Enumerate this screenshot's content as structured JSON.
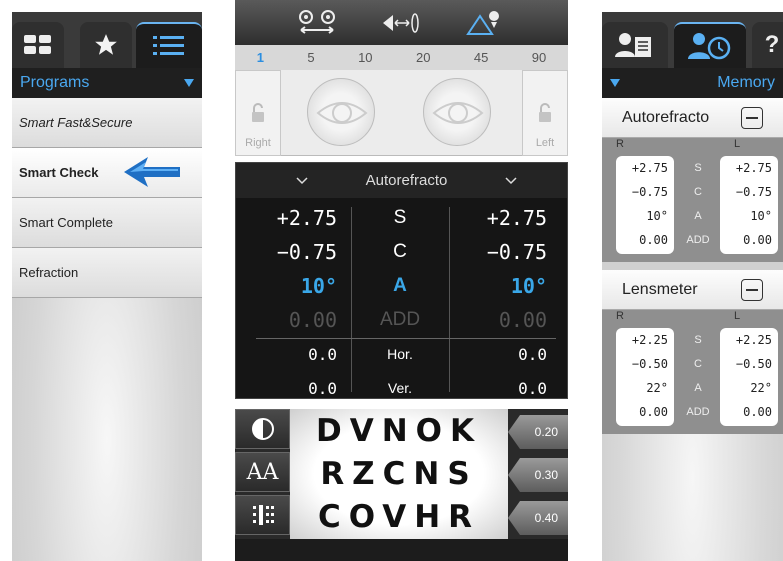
{
  "left_panel": {
    "header_title": "Programs",
    "items": [
      {
        "label": "Smart Fast&Secure",
        "italic": true
      },
      {
        "label": "Smart Check",
        "active": true
      },
      {
        "label": "Smart Complete"
      },
      {
        "label": "Refraction"
      }
    ]
  },
  "center_panel": {
    "step_values": [
      "1",
      "5",
      "10",
      "20",
      "45",
      "90"
    ],
    "selected_step": "1",
    "right_label": "Right",
    "left_label": "Left",
    "mode_title": "Autorefracto",
    "rows": [
      {
        "r": "+2.75",
        "label": "S",
        "l": "+2.75"
      },
      {
        "r": "−0.75",
        "label": "C",
        "l": "−0.75"
      },
      {
        "r": "10°",
        "label": "A",
        "l": "10°"
      },
      {
        "r": "0.00",
        "label": "ADD",
        "l": "0.00"
      },
      {
        "r": "0.0",
        "label": "Hor.",
        "l": "0.0"
      },
      {
        "r": "0.0",
        "label": "Ver.",
        "l": "0.0"
      }
    ],
    "chart_rows": [
      {
        "letters": "DVNOK",
        "acuity": "0.20"
      },
      {
        "letters": "RZCNS",
        "acuity": "0.30"
      },
      {
        "letters": "COVHR",
        "acuity": "0.40"
      }
    ],
    "tool_font_label": "AA"
  },
  "right_panel": {
    "header_title": "Memory",
    "tab_help": "?",
    "sections": [
      {
        "title": "Autorefracto",
        "r_label": "R",
        "l_label": "L",
        "rows": [
          {
            "r": "+2.75",
            "label": "S",
            "l": "+2.75"
          },
          {
            "r": "−0.75",
            "label": "C",
            "l": "−0.75"
          },
          {
            "r": "10°",
            "label": "A",
            "l": "10°"
          },
          {
            "r": "0.00",
            "label": "ADD",
            "l": "0.00"
          }
        ]
      },
      {
        "title": "Lensmeter",
        "r_label": "R",
        "l_label": "L",
        "rows": [
          {
            "r": "+2.25",
            "label": "S",
            "l": "+2.25"
          },
          {
            "r": "−0.50",
            "label": "C",
            "l": "−0.50"
          },
          {
            "r": "22°",
            "label": "A",
            "l": "22°"
          },
          {
            "r": "0.00",
            "label": "ADD",
            "l": "0.00"
          }
        ]
      }
    ]
  },
  "colors": {
    "accent_blue": "#3aa7e8",
    "dark_bg": "#151515",
    "arrow_blue": "#1f6fc4"
  },
  "icons": [
    "grid-icon",
    "star-icon",
    "list-icon",
    "patient-record-icon",
    "patient-history-icon",
    "help-icon",
    "eye-pd-icon",
    "convergence-icon",
    "mountain-target-icon",
    "lock-icon",
    "contrast-icon",
    "font-size-icon",
    "letter-grid-icon",
    "minus-icon",
    "arrow-left-icon"
  ]
}
